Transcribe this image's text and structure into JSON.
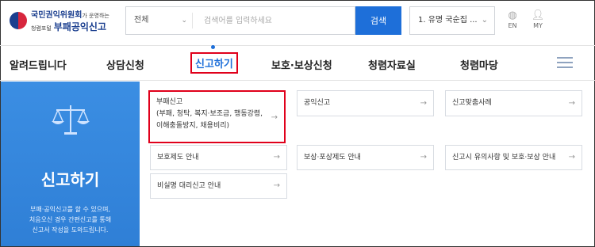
{
  "header": {
    "logo_top": "국민권익위원회",
    "logo_top_small": "가 운영하는",
    "logo_bot_small": "청렴포털",
    "logo_bot": "부패공익신고",
    "search_scope": "전체",
    "search_placeholder": "검색어를 입력하세요",
    "search_button": "검색",
    "popular_keyword": "1. 유명 국순집 ...",
    "lang_label": "EN",
    "my_label": "MY"
  },
  "nav": {
    "items": [
      "알려드립니다",
      "상담신청",
      "신고하기",
      "보호·보상신청",
      "청렴자료실",
      "청렴마당"
    ],
    "active": "신고하기"
  },
  "panel": {
    "title": "신고하기",
    "description": "부패·공익신고를 할 수 있으며,\n처음오신 경우 간편신고를 통해\n신고서 작성을 도와드립니다."
  },
  "cards": [
    {
      "title": "부패신고",
      "detail": "(부패, 청탁, 복지·보조금, 행동강령,",
      "detail2": "이해충돌방지, 채용비리)"
    },
    {
      "title": "공익신고"
    },
    {
      "title": "신고맞춤사례"
    },
    {
      "title": "보호제도 안내"
    },
    {
      "title": "보상·포상제도 안내"
    },
    {
      "title": "신고시 유의사항 및 보호·보상 안내"
    },
    {
      "title": "비실명 대리신고 안내"
    }
  ],
  "colors": {
    "accent": "#1e6fd9",
    "highlight": "#e0001b",
    "panel": "#3b8ee3"
  }
}
